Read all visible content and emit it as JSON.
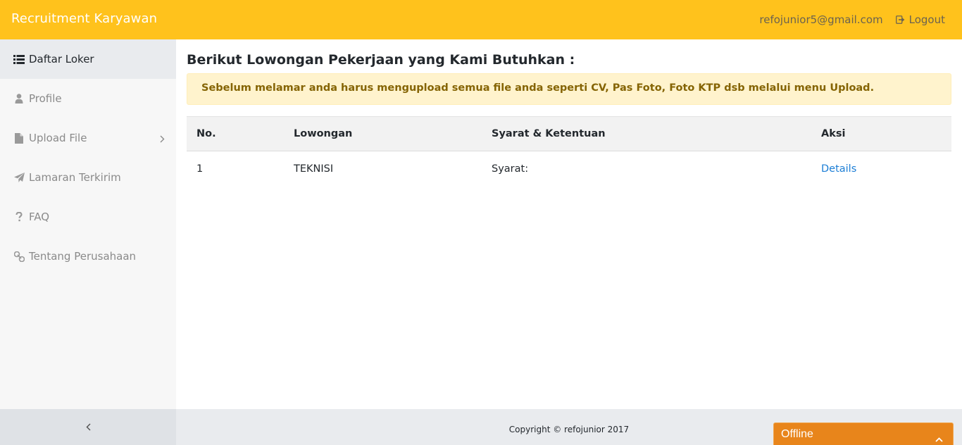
{
  "header": {
    "brand": "Recruitment Karyawan",
    "email": "refojunior5@gmail.com",
    "logout_label": "Logout",
    "bg_color": "#ffc21c"
  },
  "sidebar": {
    "items": [
      {
        "label": "Daftar Loker",
        "icon": "list-icon",
        "active": true
      },
      {
        "label": "Profile",
        "icon": "user-icon"
      },
      {
        "label": "Upload File",
        "icon": "file-icon",
        "has_submenu": true
      },
      {
        "label": "Lamaran Terkirim",
        "icon": "paper-plane-icon"
      },
      {
        "label": "FAQ",
        "icon": "question-icon"
      },
      {
        "label": "Tentang Perusahaan",
        "icon": "link-icon"
      }
    ],
    "collapse_icon": "chevron-left-icon"
  },
  "main": {
    "title": "Berikut Lowongan Pekerjaan yang Kami Butuhkan :",
    "alert": "Sebelum melamar anda harus mengupload semua file anda seperti CV, Pas Foto, Foto KTP dsb melalui menu Upload.",
    "table": {
      "headers": [
        "No.",
        "Lowongan",
        "Syarat & Ketentuan",
        "Aksi"
      ],
      "rows": [
        {
          "no": "1",
          "lowongan": "TEKNISI",
          "syarat": "Syarat:",
          "aksi": "Details"
        }
      ]
    }
  },
  "footer": {
    "copyright": "Copyright © refojunior 2017"
  },
  "chat_widget": {
    "label": "Offline",
    "color": "#e8851b"
  }
}
